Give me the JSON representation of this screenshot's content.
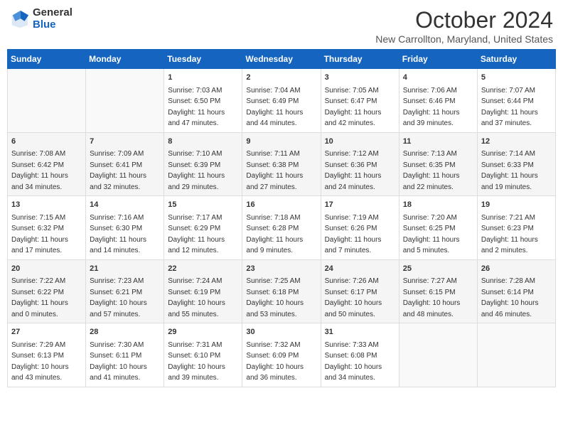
{
  "header": {
    "logo_general": "General",
    "logo_blue": "Blue",
    "month_title": "October 2024",
    "location": "New Carrollton, Maryland, United States"
  },
  "days_of_week": [
    "Sunday",
    "Monday",
    "Tuesday",
    "Wednesday",
    "Thursday",
    "Friday",
    "Saturday"
  ],
  "weeks": [
    [
      {
        "day": "",
        "content": ""
      },
      {
        "day": "",
        "content": ""
      },
      {
        "day": "1",
        "content": "Sunrise: 7:03 AM\nSunset: 6:50 PM\nDaylight: 11 hours and 47 minutes."
      },
      {
        "day": "2",
        "content": "Sunrise: 7:04 AM\nSunset: 6:49 PM\nDaylight: 11 hours and 44 minutes."
      },
      {
        "day": "3",
        "content": "Sunrise: 7:05 AM\nSunset: 6:47 PM\nDaylight: 11 hours and 42 minutes."
      },
      {
        "day": "4",
        "content": "Sunrise: 7:06 AM\nSunset: 6:46 PM\nDaylight: 11 hours and 39 minutes."
      },
      {
        "day": "5",
        "content": "Sunrise: 7:07 AM\nSunset: 6:44 PM\nDaylight: 11 hours and 37 minutes."
      }
    ],
    [
      {
        "day": "6",
        "content": "Sunrise: 7:08 AM\nSunset: 6:42 PM\nDaylight: 11 hours and 34 minutes."
      },
      {
        "day": "7",
        "content": "Sunrise: 7:09 AM\nSunset: 6:41 PM\nDaylight: 11 hours and 32 minutes."
      },
      {
        "day": "8",
        "content": "Sunrise: 7:10 AM\nSunset: 6:39 PM\nDaylight: 11 hours and 29 minutes."
      },
      {
        "day": "9",
        "content": "Sunrise: 7:11 AM\nSunset: 6:38 PM\nDaylight: 11 hours and 27 minutes."
      },
      {
        "day": "10",
        "content": "Sunrise: 7:12 AM\nSunset: 6:36 PM\nDaylight: 11 hours and 24 minutes."
      },
      {
        "day": "11",
        "content": "Sunrise: 7:13 AM\nSunset: 6:35 PM\nDaylight: 11 hours and 22 minutes."
      },
      {
        "day": "12",
        "content": "Sunrise: 7:14 AM\nSunset: 6:33 PM\nDaylight: 11 hours and 19 minutes."
      }
    ],
    [
      {
        "day": "13",
        "content": "Sunrise: 7:15 AM\nSunset: 6:32 PM\nDaylight: 11 hours and 17 minutes."
      },
      {
        "day": "14",
        "content": "Sunrise: 7:16 AM\nSunset: 6:30 PM\nDaylight: 11 hours and 14 minutes."
      },
      {
        "day": "15",
        "content": "Sunrise: 7:17 AM\nSunset: 6:29 PM\nDaylight: 11 hours and 12 minutes."
      },
      {
        "day": "16",
        "content": "Sunrise: 7:18 AM\nSunset: 6:28 PM\nDaylight: 11 hours and 9 minutes."
      },
      {
        "day": "17",
        "content": "Sunrise: 7:19 AM\nSunset: 6:26 PM\nDaylight: 11 hours and 7 minutes."
      },
      {
        "day": "18",
        "content": "Sunrise: 7:20 AM\nSunset: 6:25 PM\nDaylight: 11 hours and 5 minutes."
      },
      {
        "day": "19",
        "content": "Sunrise: 7:21 AM\nSunset: 6:23 PM\nDaylight: 11 hours and 2 minutes."
      }
    ],
    [
      {
        "day": "20",
        "content": "Sunrise: 7:22 AM\nSunset: 6:22 PM\nDaylight: 11 hours and 0 minutes."
      },
      {
        "day": "21",
        "content": "Sunrise: 7:23 AM\nSunset: 6:21 PM\nDaylight: 10 hours and 57 minutes."
      },
      {
        "day": "22",
        "content": "Sunrise: 7:24 AM\nSunset: 6:19 PM\nDaylight: 10 hours and 55 minutes."
      },
      {
        "day": "23",
        "content": "Sunrise: 7:25 AM\nSunset: 6:18 PM\nDaylight: 10 hours and 53 minutes."
      },
      {
        "day": "24",
        "content": "Sunrise: 7:26 AM\nSunset: 6:17 PM\nDaylight: 10 hours and 50 minutes."
      },
      {
        "day": "25",
        "content": "Sunrise: 7:27 AM\nSunset: 6:15 PM\nDaylight: 10 hours and 48 minutes."
      },
      {
        "day": "26",
        "content": "Sunrise: 7:28 AM\nSunset: 6:14 PM\nDaylight: 10 hours and 46 minutes."
      }
    ],
    [
      {
        "day": "27",
        "content": "Sunrise: 7:29 AM\nSunset: 6:13 PM\nDaylight: 10 hours and 43 minutes."
      },
      {
        "day": "28",
        "content": "Sunrise: 7:30 AM\nSunset: 6:11 PM\nDaylight: 10 hours and 41 minutes."
      },
      {
        "day": "29",
        "content": "Sunrise: 7:31 AM\nSunset: 6:10 PM\nDaylight: 10 hours and 39 minutes."
      },
      {
        "day": "30",
        "content": "Sunrise: 7:32 AM\nSunset: 6:09 PM\nDaylight: 10 hours and 36 minutes."
      },
      {
        "day": "31",
        "content": "Sunrise: 7:33 AM\nSunset: 6:08 PM\nDaylight: 10 hours and 34 minutes."
      },
      {
        "day": "",
        "content": ""
      },
      {
        "day": "",
        "content": ""
      }
    ]
  ]
}
